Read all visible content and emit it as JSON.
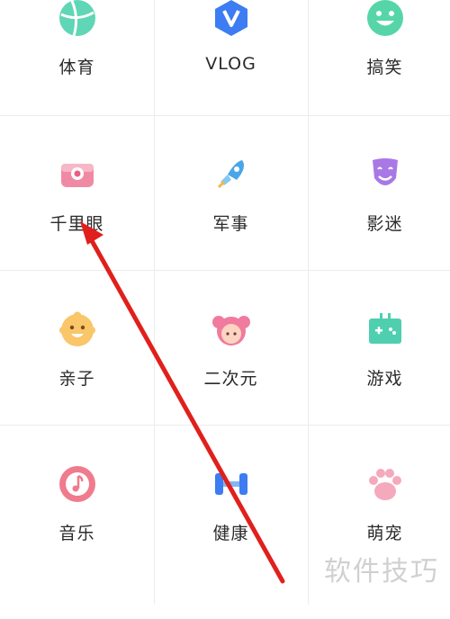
{
  "categories": [
    {
      "label": "体育",
      "icon": "basketball-icon"
    },
    {
      "label": "VLOG",
      "icon": "vlog-icon"
    },
    {
      "label": "搞笑",
      "icon": "laughing-face-icon"
    },
    {
      "label": "千里眼",
      "icon": "camera-icon"
    },
    {
      "label": "军事",
      "icon": "rocket-icon"
    },
    {
      "label": "影迷",
      "icon": "theater-mask-icon"
    },
    {
      "label": "亲子",
      "icon": "baby-face-icon"
    },
    {
      "label": "二次元",
      "icon": "anime-girl-icon"
    },
    {
      "label": "游戏",
      "icon": "game-console-icon"
    },
    {
      "label": "音乐",
      "icon": "music-note-icon"
    },
    {
      "label": "健康",
      "icon": "dumbbell-icon"
    },
    {
      "label": "萌宠",
      "icon": "paw-icon"
    }
  ],
  "watermark": "软件技巧",
  "annotation_color": "#e0201c"
}
